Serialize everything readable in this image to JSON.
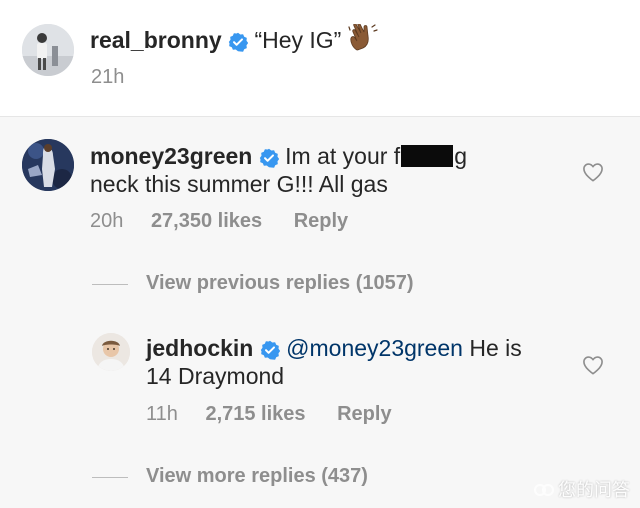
{
  "post": {
    "username": "real_bronny",
    "caption": "“Hey IG”",
    "time": "21h"
  },
  "comment1": {
    "username": "money23green",
    "text_before_redaction": "Im at your f",
    "text_after_redaction": "g",
    "text_line2": "neck this summer G!!! All gas",
    "time": "20h",
    "likes": "27,350 likes",
    "reply_label": "Reply"
  },
  "view_previous": "View previous replies (1057)",
  "reply1": {
    "username": "jedhockin",
    "mention": "@money23green",
    "text_after_mention": " He is",
    "text_line2": "14 Draymond",
    "time": "11h",
    "likes": "2,715 likes",
    "reply_label": "Reply"
  },
  "view_more": "View more replies (437)",
  "watermark": "您的问答",
  "colors": {
    "text": "#262626",
    "secondary": "#8e8e8e",
    "verified": "#3897f0",
    "mention": "#003569",
    "redaction": "#0b0b0b"
  },
  "icons": {
    "verified": "verified-badge-icon",
    "heart": "heart-outline-icon",
    "wave": "waving-hand-emoji",
    "watermark_logo": "wukong-logo-icon"
  }
}
